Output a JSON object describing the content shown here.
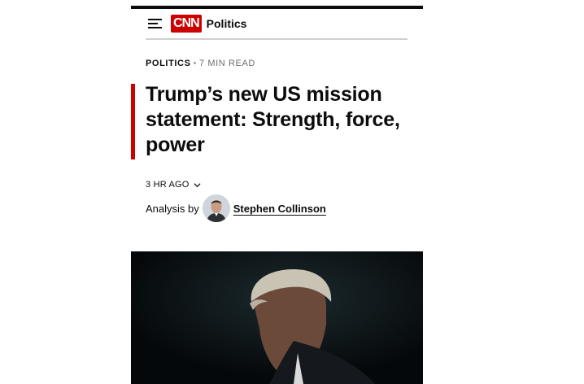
{
  "header": {
    "menu_icon": "hamburger-menu-icon",
    "logo_text": "CNN",
    "section": "Politics",
    "brand_color": "#cc0000"
  },
  "article": {
    "kicker_section": "POLITICS",
    "kicker_separator": "•",
    "read_time": "7 MIN READ",
    "headline": "Trump’s new US mission statement: Strength, force, power",
    "timestamp": "3 HR AGO",
    "timestamp_icon": "chevron-down-icon",
    "byline_prefix": "Analysis by",
    "author": "Stephen Collinson"
  }
}
